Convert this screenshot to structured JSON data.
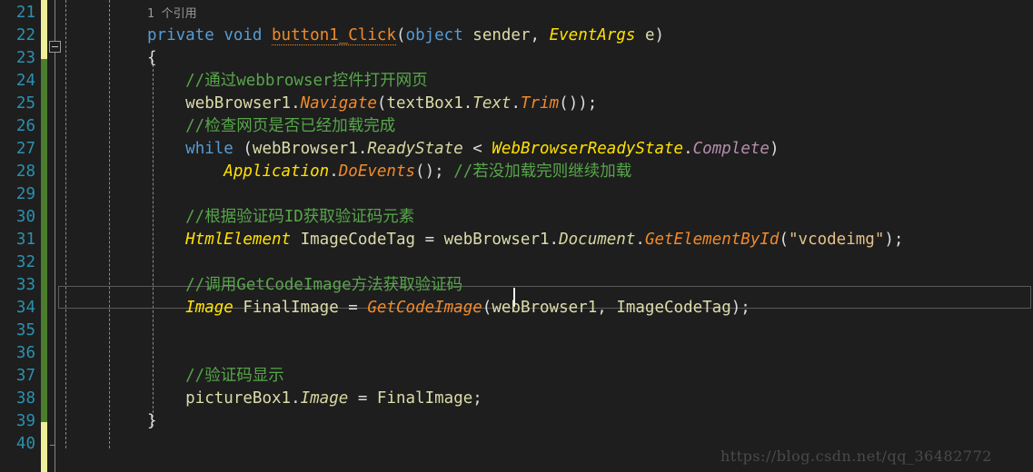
{
  "editor": {
    "background": "#1e1e1e",
    "line_height": 25,
    "first_visible_line": 21,
    "last_visible_line": 40
  },
  "gutter": {
    "line_numbers": [
      "21",
      "22",
      "23",
      "24",
      "25",
      "26",
      "27",
      "28",
      "29",
      "30",
      "31",
      "32",
      "33",
      "34",
      "35",
      "36",
      "37",
      "38",
      "39",
      "40"
    ],
    "line_number_color": "#2b91af",
    "change_bar": {
      "unsaved_color": "#eeee9b",
      "saved_color": "#4b7d2f"
    },
    "fold_toggle": {
      "glyph": "minus",
      "at_line": 22
    }
  },
  "codelens": {
    "text": "1 个引用",
    "at_line": 22,
    "color": "#9a9a9a"
  },
  "current_line": {
    "number": 33,
    "border_color": "#5a5a5a"
  },
  "code": {
    "lines": [
      {
        "n": 21,
        "tokens": []
      },
      {
        "n": 22,
        "tokens": [
          {
            "t": "private",
            "c": "kw"
          },
          {
            "t": " ",
            "c": "plain"
          },
          {
            "t": "void",
            "c": "kw"
          },
          {
            "t": " ",
            "c": "plain"
          },
          {
            "t": "button1_Click",
            "c": "method-u"
          },
          {
            "t": "(",
            "c": "punc"
          },
          {
            "t": "object",
            "c": "kw"
          },
          {
            "t": " sender",
            "c": "ident"
          },
          {
            "t": ", ",
            "c": "punc"
          },
          {
            "t": "EventArgs",
            "c": "type"
          },
          {
            "t": " e",
            "c": "ident"
          },
          {
            "t": ")",
            "c": "punc"
          }
        ]
      },
      {
        "n": 23,
        "tokens": [
          {
            "t": "{",
            "c": "brace"
          }
        ]
      },
      {
        "n": 24,
        "tokens": [
          {
            "t": "    //通过webbrowser控件打开网页",
            "c": "comment"
          }
        ]
      },
      {
        "n": 25,
        "tokens": [
          {
            "t": "    ",
            "c": "plain"
          },
          {
            "t": "webBrowser1",
            "c": "ident"
          },
          {
            "t": ".",
            "c": "punc"
          },
          {
            "t": "Navigate",
            "c": "method"
          },
          {
            "t": "(",
            "c": "punc"
          },
          {
            "t": "textBox1",
            "c": "ident"
          },
          {
            "t": ".",
            "c": "punc"
          },
          {
            "t": "Text",
            "c": "prop"
          },
          {
            "t": ".",
            "c": "punc"
          },
          {
            "t": "Trim",
            "c": "method"
          },
          {
            "t": "());",
            "c": "punc"
          }
        ]
      },
      {
        "n": 26,
        "tokens": [
          {
            "t": "    //检查网页是否已经加载完成",
            "c": "comment"
          }
        ]
      },
      {
        "n": 27,
        "tokens": [
          {
            "t": "    ",
            "c": "plain"
          },
          {
            "t": "while",
            "c": "kw"
          },
          {
            "t": " (",
            "c": "punc"
          },
          {
            "t": "webBrowser1",
            "c": "ident"
          },
          {
            "t": ".",
            "c": "punc"
          },
          {
            "t": "ReadyState",
            "c": "prop"
          },
          {
            "t": " ",
            "c": "plain"
          },
          {
            "t": "<",
            "c": "punc"
          },
          {
            "t": " ",
            "c": "plain"
          },
          {
            "t": "WebBrowserReadyState",
            "c": "cls"
          },
          {
            "t": ".",
            "c": "punc"
          },
          {
            "t": "Complete",
            "c": "enumval"
          },
          {
            "t": ")",
            "c": "punc"
          }
        ]
      },
      {
        "n": 28,
        "tokens": [
          {
            "t": "        ",
            "c": "plain"
          },
          {
            "t": "Application",
            "c": "cls"
          },
          {
            "t": ".",
            "c": "punc"
          },
          {
            "t": "DoEvents",
            "c": "method"
          },
          {
            "t": "(); ",
            "c": "punc"
          },
          {
            "t": "//若没加载完则继续加载",
            "c": "comment"
          }
        ]
      },
      {
        "n": 29,
        "tokens": []
      },
      {
        "n": 30,
        "tokens": [
          {
            "t": "    //根据验证码ID获取验证码元素",
            "c": "comment"
          }
        ]
      },
      {
        "n": 31,
        "tokens": [
          {
            "t": "    ",
            "c": "plain"
          },
          {
            "t": "HtmlElement",
            "c": "type"
          },
          {
            "t": " ImageCodeTag",
            "c": "ident"
          },
          {
            "t": " = ",
            "c": "punc"
          },
          {
            "t": "webBrowser1",
            "c": "ident"
          },
          {
            "t": ".",
            "c": "punc"
          },
          {
            "t": "Document",
            "c": "prop"
          },
          {
            "t": ".",
            "c": "punc"
          },
          {
            "t": "GetElementById",
            "c": "method"
          },
          {
            "t": "(",
            "c": "punc"
          },
          {
            "t": "\"vcodeimg\"",
            "c": "string"
          },
          {
            "t": ");",
            "c": "punc"
          }
        ]
      },
      {
        "n": 32,
        "tokens": []
      },
      {
        "n": 33,
        "tokens": [
          {
            "t": "    //调用GetCodeImage方法获取验证码",
            "c": "comment"
          }
        ]
      },
      {
        "n": 34,
        "tokens": [
          {
            "t": "    ",
            "c": "plain"
          },
          {
            "t": "Image",
            "c": "type"
          },
          {
            "t": " FinalImage",
            "c": "ident"
          },
          {
            "t": " = ",
            "c": "punc"
          },
          {
            "t": "GetCodeImage",
            "c": "method"
          },
          {
            "t": "(",
            "c": "punc"
          },
          {
            "t": "webBrowser1",
            "c": "ident"
          },
          {
            "t": ", ",
            "c": "punc"
          },
          {
            "t": "ImageCodeTag",
            "c": "ident"
          },
          {
            "t": ");",
            "c": "punc"
          }
        ]
      },
      {
        "n": 35,
        "tokens": []
      },
      {
        "n": 36,
        "tokens": []
      },
      {
        "n": 37,
        "tokens": [
          {
            "t": "    //验证码显示",
            "c": "comment"
          }
        ]
      },
      {
        "n": 38,
        "tokens": [
          {
            "t": "    ",
            "c": "plain"
          },
          {
            "t": "pictureBox1",
            "c": "ident"
          },
          {
            "t": ".",
            "c": "punc"
          },
          {
            "t": "Image",
            "c": "prop"
          },
          {
            "t": " = ",
            "c": "punc"
          },
          {
            "t": "FinalImage",
            "c": "ident"
          },
          {
            "t": ";",
            "c": "punc"
          }
        ]
      },
      {
        "n": 39,
        "tokens": [
          {
            "t": "}",
            "c": "brace"
          }
        ]
      },
      {
        "n": 40,
        "tokens": []
      }
    ]
  },
  "watermark": {
    "text": "https://blog.csdn.net/qq_36482772",
    "color": "#4a4a4a"
  }
}
